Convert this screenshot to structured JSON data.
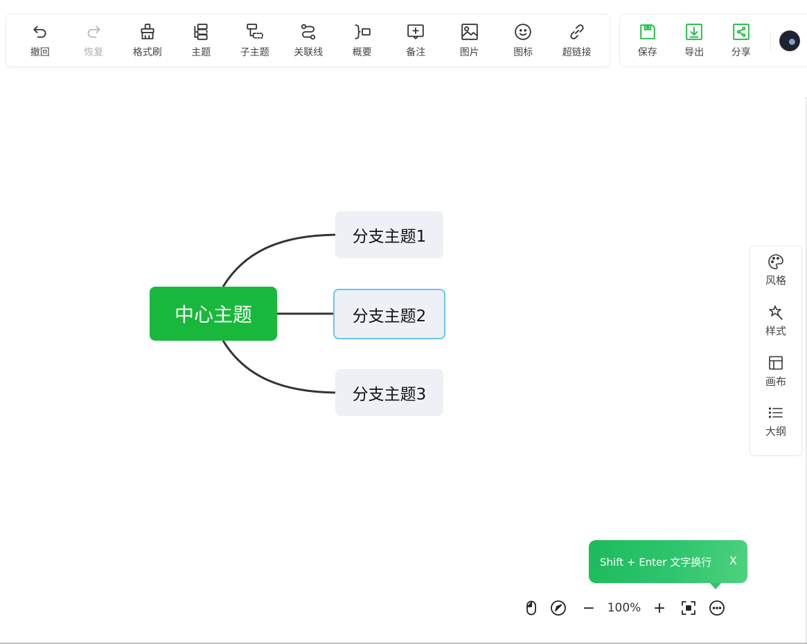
{
  "toolbar": {
    "undo": "撤回",
    "redo": "恢复",
    "format_painter": "格式刷",
    "topic": "主题",
    "subtopic": "子主题",
    "relation": "关联线",
    "summary": "概要",
    "note": "备注",
    "image": "图片",
    "icon": "图标",
    "hyperlink": "超链接"
  },
  "toolbar_right": {
    "save": "保存",
    "export": "导出",
    "share": "分享"
  },
  "mindmap": {
    "root": "中心主题",
    "branches": [
      "分支主题1",
      "分支主题2",
      "分支主题3"
    ]
  },
  "sidebar": {
    "items": [
      {
        "label": "风格",
        "icon": "palette-icon"
      },
      {
        "label": "样式",
        "icon": "magic-wand-icon"
      },
      {
        "label": "画布",
        "icon": "layout-icon"
      },
      {
        "label": "大纲",
        "icon": "list-icon"
      }
    ]
  },
  "tooltip": {
    "text": "Shift + Enter 文字换行",
    "close": "X"
  },
  "zoom": {
    "minus": "−",
    "level": "100%",
    "plus": "+"
  },
  "colors": {
    "accent": "#18b83c",
    "branch_bg": "#edf1f5",
    "selected_border": "#6ec3ee"
  }
}
